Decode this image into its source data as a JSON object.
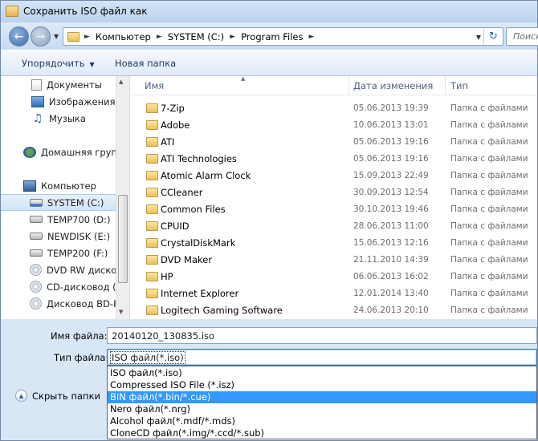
{
  "window": {
    "title": "Сохранить ISO файл как"
  },
  "address": {
    "crumbs": [
      "Компьютер",
      "SYSTEM (C:)",
      "Program Files"
    ],
    "search_placeholder": "Поиск"
  },
  "toolbar": {
    "organize_label": "Упорядочить",
    "new_folder_label": "Новая папка"
  },
  "sidebar": {
    "items": [
      {
        "label": "Документы",
        "icon": "documents-icon"
      },
      {
        "label": "Изображения",
        "icon": "pictures-icon"
      },
      {
        "label": "Музыка",
        "icon": "music-icon"
      },
      {
        "label": "Домашняя групп",
        "icon": "homegroup-icon"
      },
      {
        "label": "Компьютер",
        "icon": "computer-icon"
      },
      {
        "label": "SYSTEM (C:)",
        "icon": "system-drive-icon",
        "selected": true
      },
      {
        "label": "TEMP700 (D:)",
        "icon": "drive-icon"
      },
      {
        "label": "NEWDISK (E:)",
        "icon": "drive-icon"
      },
      {
        "label": "TEMP200 (F:)",
        "icon": "drive-icon"
      },
      {
        "label": "DVD RW дисков",
        "icon": "dvd-drive-icon"
      },
      {
        "label": "CD-дисковод (H",
        "icon": "cd-drive-icon"
      },
      {
        "label": "Дисковод BD-R",
        "icon": "bd-drive-icon"
      }
    ]
  },
  "filelist": {
    "columns": [
      "Имя",
      "Дата изменения",
      "Тип"
    ],
    "rows": [
      {
        "name": "7-Zip",
        "date": "05.06.2013 19:39",
        "type": "Папка с файлами"
      },
      {
        "name": "Adobe",
        "date": "10.06.2013 13:01",
        "type": "Папка с файлами"
      },
      {
        "name": "ATI",
        "date": "05.06.2013 19:16",
        "type": "Папка с файлами"
      },
      {
        "name": "ATI Technologies",
        "date": "05.06.2013 19:16",
        "type": "Папка с файлами"
      },
      {
        "name": "Atomic Alarm Clock",
        "date": "15.09.2013 22:49",
        "type": "Папка с файлами"
      },
      {
        "name": "CCleaner",
        "date": "30.09.2013 12:54",
        "type": "Папка с файлами"
      },
      {
        "name": "Common Files",
        "date": "30.10.2013 19:46",
        "type": "Папка с файлами"
      },
      {
        "name": "CPUID",
        "date": "28.06.2013 11:00",
        "type": "Папка с файлами"
      },
      {
        "name": "CrystalDiskMark",
        "date": "15.06.2013 12:16",
        "type": "Папка с файлами"
      },
      {
        "name": "DVD Maker",
        "date": "21.11.2010 14:39",
        "type": "Папка с файлами"
      },
      {
        "name": "HP",
        "date": "06.06.2013 16:02",
        "type": "Папка с файлами"
      },
      {
        "name": "Internet Explorer",
        "date": "12.01.2014 13:40",
        "type": "Папка с файлами"
      },
      {
        "name": "Logitech Gaming Software",
        "date": "24.06.2013 20:10",
        "type": "Папка с файлами"
      }
    ]
  },
  "form": {
    "filename_label": "Имя файла:",
    "filename_value": "20140120_130835.iso",
    "filetype_label": "Тип файла:",
    "filetype_value": "ISO файл(*.iso)",
    "filetype_options": [
      "ISO файл(*.iso)",
      "Compressed ISO File (*.isz)",
      "BIN файл(*.bin/*.cue)",
      "Nero файл(*.nrg)",
      "Alcohol файл(*.mdf/*.mds)",
      "CloneCD файл(*.img/*.ccd/*.sub)"
    ],
    "filetype_highlighted_index": 2,
    "hide_folders_label": "Скрыть папки"
  },
  "colors": {
    "highlight": "#3399ff",
    "window_frame": "#bcd2ee"
  }
}
